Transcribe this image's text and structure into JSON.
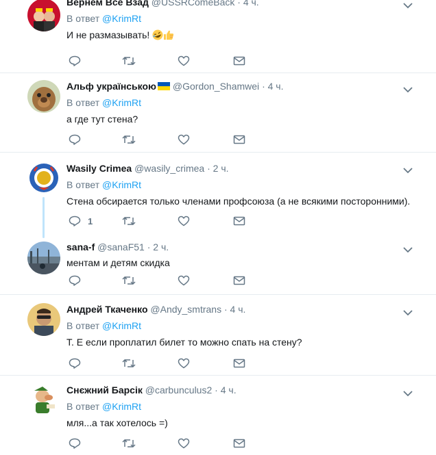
{
  "tweets": [
    {
      "name": "Вернем Все Взад",
      "handle": "@USSRComeBack",
      "time": "4 ч.",
      "reply_prefix": "В ответ",
      "reply_to": "@KrimRt",
      "text": "И не размазывать! ",
      "emojis": [
        "rolling-laughing-emoji",
        "thumbs-up-emoji"
      ],
      "reply_count": ""
    },
    {
      "name": "Альф українською",
      "handle": "@Gordon_Shamwei",
      "time": "4 ч.",
      "reply_prefix": "В ответ",
      "reply_to": "@KrimRt",
      "text": "а где тут стена?",
      "reply_count": ""
    },
    {
      "name": "Wasily Crimea",
      "handle": "@wasily_crimea",
      "time": "2 ч.",
      "reply_prefix": "В ответ",
      "reply_to": "@KrimRt",
      "text": "Стена обсирается только членами профсоюза (а не всякими посторонними).",
      "reply_count": "1"
    },
    {
      "name": "sana-f",
      "handle": "@sanaF51",
      "time": "2 ч.",
      "text": "ментам и детям скидка",
      "reply_count": ""
    },
    {
      "name": "Андрей Ткаченко",
      "handle": "@Andy_smtrans",
      "time": "4 ч.",
      "reply_prefix": "В ответ",
      "reply_to": "@KrimRt",
      "text": "Т. Е если проплатил билет то можно спать на стену?",
      "reply_count": ""
    },
    {
      "name": "Снєжний Барсік",
      "handle": "@carbunculus2",
      "time": "4 ч.",
      "reply_prefix": "В ответ",
      "reply_to": "@KrimRt",
      "text": "мля...а так хотелось =)",
      "reply_count": ""
    }
  ],
  "colors": {
    "icon_gray": "#657786",
    "mention_blue": "#1da1f2",
    "divider": "#e6ecf0",
    "thread_line": "#bfe4fb"
  }
}
